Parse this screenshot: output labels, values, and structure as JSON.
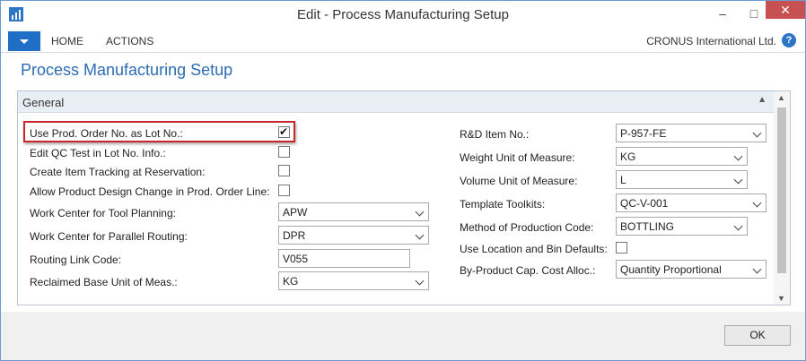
{
  "window": {
    "title": "Edit - Process Manufacturing Setup"
  },
  "ribbon": {
    "tabs": [
      "HOME",
      "ACTIONS"
    ],
    "company": "CRONUS International Ltd.",
    "help": "?"
  },
  "page": {
    "title": "Process Manufacturing Setup"
  },
  "section": {
    "title": "General"
  },
  "left_fields": [
    {
      "label": "Use Prod. Order No. as Lot No.:",
      "type": "checkbox",
      "checked": true
    },
    {
      "label": "Edit QC Test in Lot No. Info.:",
      "type": "checkbox",
      "checked": false
    },
    {
      "label": "Create Item Tracking at Reservation:",
      "type": "checkbox",
      "checked": false
    },
    {
      "label": "Allow Product Design Change in Prod. Order Line:",
      "type": "checkbox",
      "checked": false
    },
    {
      "label": "Work Center for Tool Planning:",
      "type": "select",
      "value": "APW"
    },
    {
      "label": "Work Center for Parallel Routing:",
      "type": "select",
      "value": "DPR"
    },
    {
      "label": "Routing Link Code:",
      "type": "text",
      "value": "V055"
    },
    {
      "label": "Reclaimed Base Unit of Meas.:",
      "type": "select",
      "value": "KG"
    }
  ],
  "right_fields": [
    {
      "label": "R&D Item No.:",
      "type": "select",
      "value": "P-957-FE"
    },
    {
      "label": "Weight Unit of Measure:",
      "type": "select",
      "value": "KG"
    },
    {
      "label": "Volume Unit of Measure:",
      "type": "select",
      "value": "L"
    },
    {
      "label": "Template Toolkits:",
      "type": "select",
      "value": "QC-V-001"
    },
    {
      "label": "Method of Production Code:",
      "type": "select",
      "value": "BOTTLING"
    },
    {
      "label": "Use Location and Bin Defaults:",
      "type": "checkbox",
      "checked": false
    },
    {
      "label": "By-Product Cap. Cost Alloc.:",
      "type": "select",
      "value": "Quantity Proportional"
    }
  ],
  "buttons": {
    "ok": "OK"
  },
  "colors": {
    "accent": "#2b6cb3",
    "close": "#c75050",
    "highlight": "#c9252c"
  }
}
